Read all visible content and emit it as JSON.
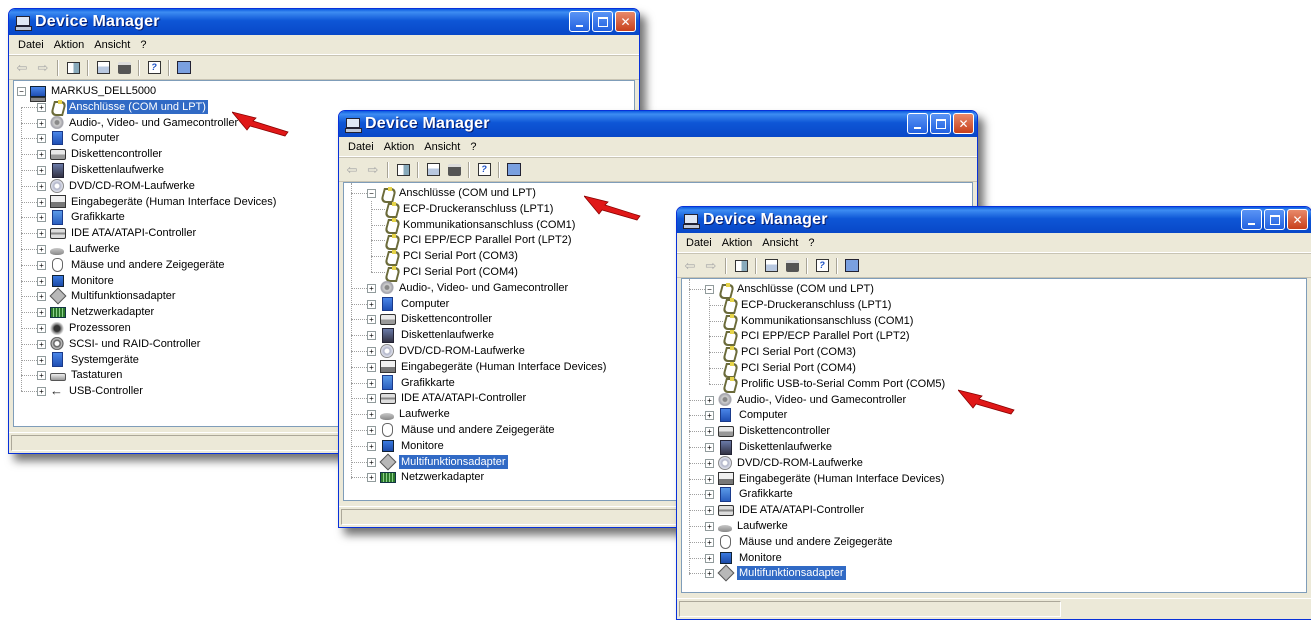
{
  "window_title": "Device Manager",
  "menu": [
    "Datei",
    "Aktion",
    "Ansicht",
    "?"
  ],
  "toolbar_icons": [
    "back-icon",
    "forward-icon",
    "console-tree-icon",
    "properties-icon",
    "print-icon",
    "help-icon",
    "scan-hardware-icon"
  ],
  "windows": [
    {
      "id": "window-1",
      "tree": {
        "root": {
          "label": "MARKUS_DELL5000",
          "expander": "−"
        },
        "categories": [
          {
            "label": "Anschlüsse (COM und LPT)",
            "icon": "port-icon",
            "selected": true
          },
          {
            "label": "Audio-, Video- und Gamecontroller",
            "icon": "audio-icon"
          },
          {
            "label": "Computer",
            "icon": "computer-icon"
          },
          {
            "label": "Diskettencontroller",
            "icon": "floppy-controller-icon"
          },
          {
            "label": "Diskettenlaufwerke",
            "icon": "floppy-drive-icon"
          },
          {
            "label": "DVD/CD-ROM-Laufwerke",
            "icon": "dvd-icon"
          },
          {
            "label": "Eingabegeräte (Human Interface Devices)",
            "icon": "hid-icon"
          },
          {
            "label": "Grafikkarte",
            "icon": "graphics-card-icon"
          },
          {
            "label": "IDE ATA/ATAPI-Controller",
            "icon": "ide-controller-icon"
          },
          {
            "label": "Laufwerke",
            "icon": "drive-icon"
          },
          {
            "label": "Mäuse und andere Zeigegeräte",
            "icon": "mouse-icon"
          },
          {
            "label": "Monitore",
            "icon": "monitor-icon"
          },
          {
            "label": "Multifunktionsadapter",
            "icon": "multifunction-icon"
          },
          {
            "label": "Netzwerkadapter",
            "icon": "network-adapter-icon"
          },
          {
            "label": "Prozessoren",
            "icon": "processor-icon"
          },
          {
            "label": "SCSI- und RAID-Controller",
            "icon": "scsi-icon"
          },
          {
            "label": "Systemgeräte",
            "icon": "system-icon"
          },
          {
            "label": "Tastaturen",
            "icon": "keyboard-icon"
          },
          {
            "label": "USB-Controller",
            "icon": "usb-icon"
          }
        ]
      }
    },
    {
      "id": "window-2",
      "tree": {
        "expanded": {
          "label": "Anschlüsse (COM und LPT)",
          "children": [
            "ECP-Druckeranschluss (LPT1)",
            "Kommunikationsanschluss (COM1)",
            "PCI EPP/ECP Parallel Port (LPT2)",
            "PCI Serial Port (COM3)",
            "PCI Serial Port (COM4)"
          ]
        },
        "categories": [
          {
            "label": "Audio-, Video- und Gamecontroller",
            "icon": "audio-icon"
          },
          {
            "label": "Computer",
            "icon": "computer-icon"
          },
          {
            "label": "Diskettencontroller",
            "icon": "floppy-controller-icon"
          },
          {
            "label": "Diskettenlaufwerke",
            "icon": "floppy-drive-icon"
          },
          {
            "label": "DVD/CD-ROM-Laufwerke",
            "icon": "dvd-icon"
          },
          {
            "label": "Eingabegeräte (Human Interface Devices)",
            "icon": "hid-icon"
          },
          {
            "label": "Grafikkarte",
            "icon": "graphics-card-icon"
          },
          {
            "label": "IDE ATA/ATAPI-Controller",
            "icon": "ide-controller-icon"
          },
          {
            "label": "Laufwerke",
            "icon": "drive-icon"
          },
          {
            "label": "Mäuse und andere Zeigegeräte",
            "icon": "mouse-icon"
          },
          {
            "label": "Monitore",
            "icon": "monitor-icon"
          },
          {
            "label": "Multifunktionsadapter",
            "icon": "multifunction-icon",
            "selected": true
          },
          {
            "label": "Netzwerkadapter",
            "icon": "network-adapter-icon"
          }
        ]
      }
    },
    {
      "id": "window-3",
      "tree": {
        "expanded": {
          "label": "Anschlüsse (COM und LPT)",
          "children": [
            "ECP-Druckeranschluss (LPT1)",
            "Kommunikationsanschluss (COM1)",
            "PCI EPP/ECP Parallel Port (LPT2)",
            "PCI Serial Port (COM3)",
            "PCI Serial Port (COM4)",
            "Prolific USB-to-Serial Comm Port (COM5)"
          ]
        },
        "categories": [
          {
            "label": "Audio-, Video- und Gamecontroller",
            "icon": "audio-icon"
          },
          {
            "label": "Computer",
            "icon": "computer-icon"
          },
          {
            "label": "Diskettencontroller",
            "icon": "floppy-controller-icon"
          },
          {
            "label": "Diskettenlaufwerke",
            "icon": "floppy-drive-icon"
          },
          {
            "label": "DVD/CD-ROM-Laufwerke",
            "icon": "dvd-icon"
          },
          {
            "label": "Eingabegeräte (Human Interface Devices)",
            "icon": "hid-icon"
          },
          {
            "label": "Grafikkarte",
            "icon": "graphics-card-icon"
          },
          {
            "label": "IDE ATA/ATAPI-Controller",
            "icon": "ide-controller-icon"
          },
          {
            "label": "Laufwerke",
            "icon": "drive-icon"
          },
          {
            "label": "Mäuse und andere Zeigegeräte",
            "icon": "mouse-icon"
          },
          {
            "label": "Monitore",
            "icon": "monitor-icon"
          },
          {
            "label": "Multifunktionsadapter",
            "icon": "multifunction-icon",
            "selected": true
          }
        ]
      }
    }
  ],
  "colors": {
    "selection": "#316ac5",
    "titlebar": "#0848c8",
    "arrow": "#e01818",
    "window_bg": "#ece9d8"
  }
}
